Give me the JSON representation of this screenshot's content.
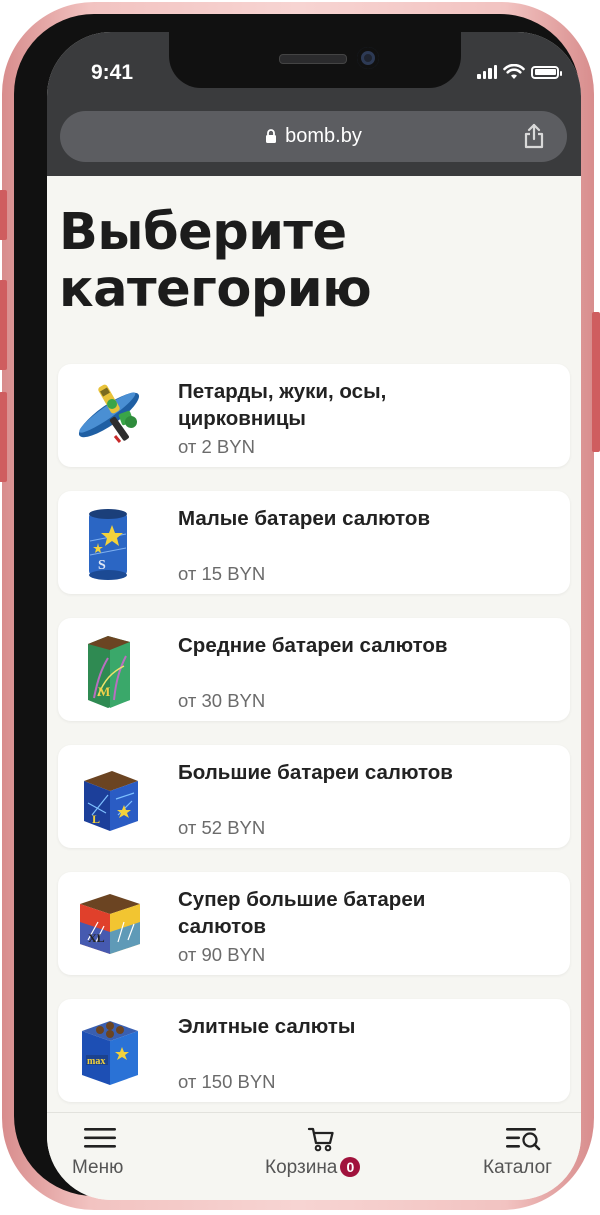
{
  "status_bar": {
    "time": "9:41"
  },
  "browser": {
    "url": "bomb.by"
  },
  "page": {
    "title": "Выберите категорию"
  },
  "categories": [
    {
      "title": "Петарды, жуки, осы, цирковницы",
      "price": "от 2 BYN",
      "icon": "firecracker-icon"
    },
    {
      "title": "Малые батареи салютов",
      "price": "от 15 BYN",
      "icon": "small-battery-icon"
    },
    {
      "title": "Средние батареи салютов",
      "price": "от 30 BYN",
      "icon": "medium-battery-icon"
    },
    {
      "title": "Большие батареи салютов",
      "price": "от 52 BYN",
      "icon": "large-battery-icon"
    },
    {
      "title": "Супер большие батареи салютов",
      "price": "от 90 BYN",
      "icon": "super-large-battery-icon"
    },
    {
      "title": "Элитные салюты",
      "price": "от 150 BYN",
      "icon": "elite-fireworks-icon"
    }
  ],
  "bottom_nav": {
    "menu_label": "Меню",
    "cart_label": "Корзина",
    "cart_count": "0",
    "catalog_label": "Каталог"
  },
  "colors": {
    "accent": "#a0123c",
    "background": "#f6f6f2",
    "phone_frame": "#f2c3c1"
  }
}
